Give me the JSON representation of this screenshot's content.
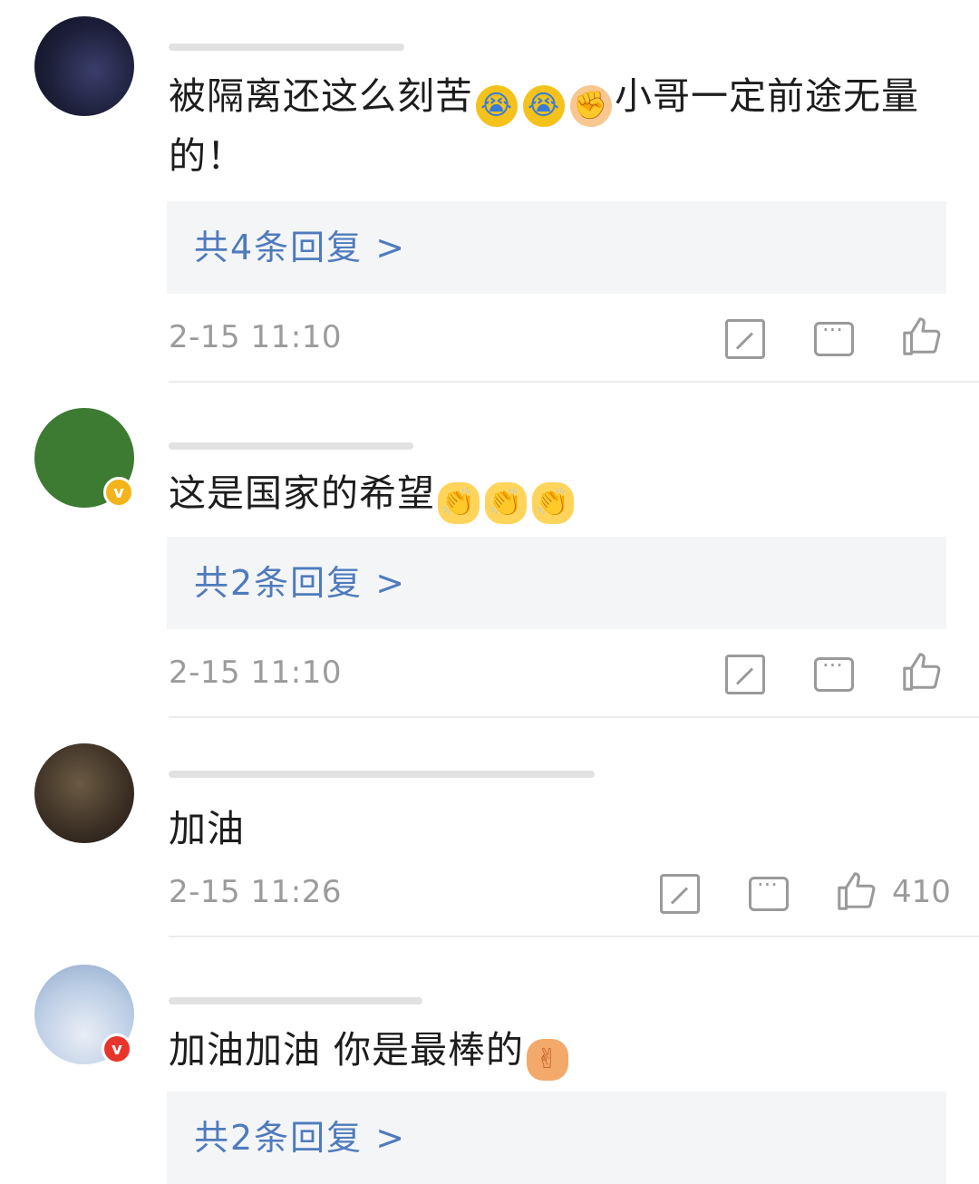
{
  "comments": [
    {
      "text": "被隔离还这么刻苦",
      "emojis": [
        "crying-face",
        "crying-face",
        "fist"
      ],
      "text_after": "小哥一定前途无量的！",
      "reply_label": "共4条回复 >",
      "time": "2-15 11:10",
      "likes": ""
    },
    {
      "text": "这是国家的希望",
      "emojis": [
        "clapping-hands",
        "clapping-hands",
        "clapping-hands"
      ],
      "reply_label": "共2条回复 >",
      "time": "2-15 11:10",
      "likes": ""
    },
    {
      "text": "加油",
      "time": "2-15 11:26",
      "likes": "410"
    },
    {
      "text": "加油加油 你是最棒的",
      "emojis": [
        "victory-hand"
      ],
      "reply_label": "共2条回复 >"
    }
  ],
  "icons": {
    "share": "share-icon",
    "comment": "comment-icon",
    "like": "thumbs-up-icon"
  },
  "colors": {
    "reply_link": "#4f7bbd",
    "verified_gold": "#f3b31a",
    "verified_red": "#e8352b",
    "meta_gray": "#9b9b9b"
  }
}
